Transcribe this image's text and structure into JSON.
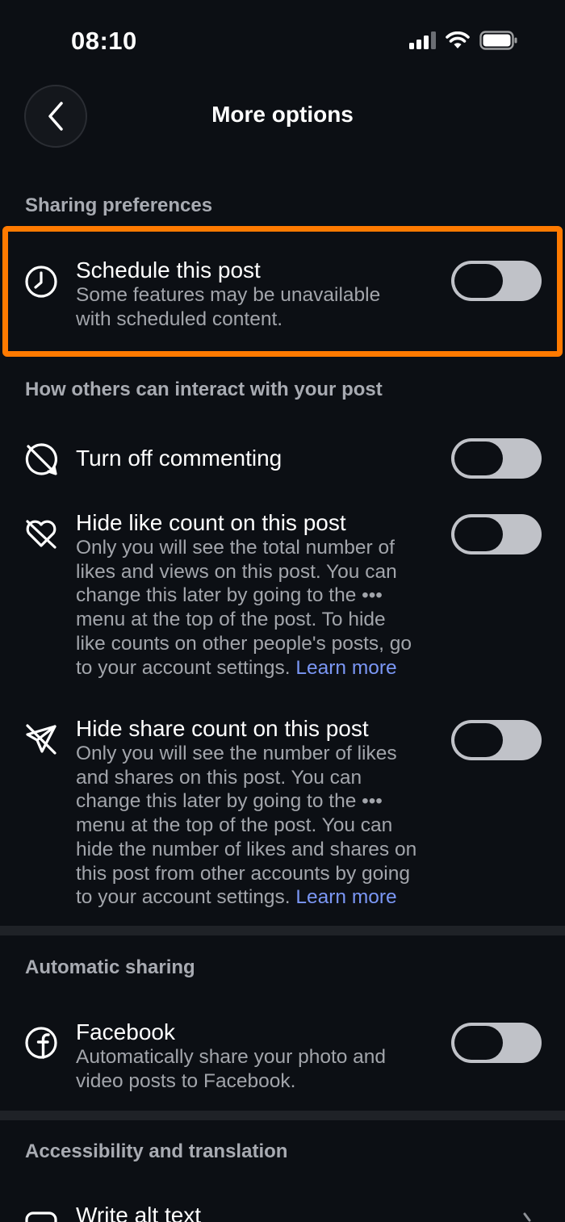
{
  "status_bar": {
    "time": "08:10"
  },
  "header": {
    "title": "More options"
  },
  "sections": {
    "sharing": {
      "header": "Sharing preferences",
      "schedule": {
        "title": "Schedule this post",
        "desc_line1": "Some features may be unavailable",
        "desc_line2": "with scheduled content.",
        "toggle_on": false
      }
    },
    "interact": {
      "header": "How others can interact with your post",
      "commenting": {
        "title": "Turn off commenting",
        "toggle_on": false
      },
      "like_count": {
        "title": "Hide like count on this post",
        "lines": [
          "Only you will see the total number of",
          "likes and views on this post. You can",
          "change this later by going to the •••",
          "menu at the top of the post. To hide",
          "like counts on other people's posts, go",
          "to your account settings. "
        ],
        "link": "Learn more",
        "toggle_on": false
      },
      "share_count": {
        "title": "Hide share count on this post",
        "lines": [
          "Only you will see the number of likes",
          "and shares on this post. You can",
          "change this later by going to the •••",
          "menu at the top of the post. You can",
          "hide the number of likes and shares on",
          "this post from other accounts by going",
          "to your account settings. "
        ],
        "link": "Learn more",
        "toggle_on": false
      }
    },
    "auto_sharing": {
      "header": "Automatic sharing",
      "facebook": {
        "title": "Facebook",
        "desc_line1": "Automatically share your photo and",
        "desc_line2": "video posts to Facebook.",
        "toggle_on": false
      }
    },
    "accessibility": {
      "header": "Accessibility and translation",
      "alt_text": {
        "title": "Write alt text"
      }
    }
  },
  "colors": {
    "background": "#0c0f14",
    "highlight": "#ff7a00",
    "link": "#7b97f5",
    "toggle_track": "#c0c2c8"
  }
}
